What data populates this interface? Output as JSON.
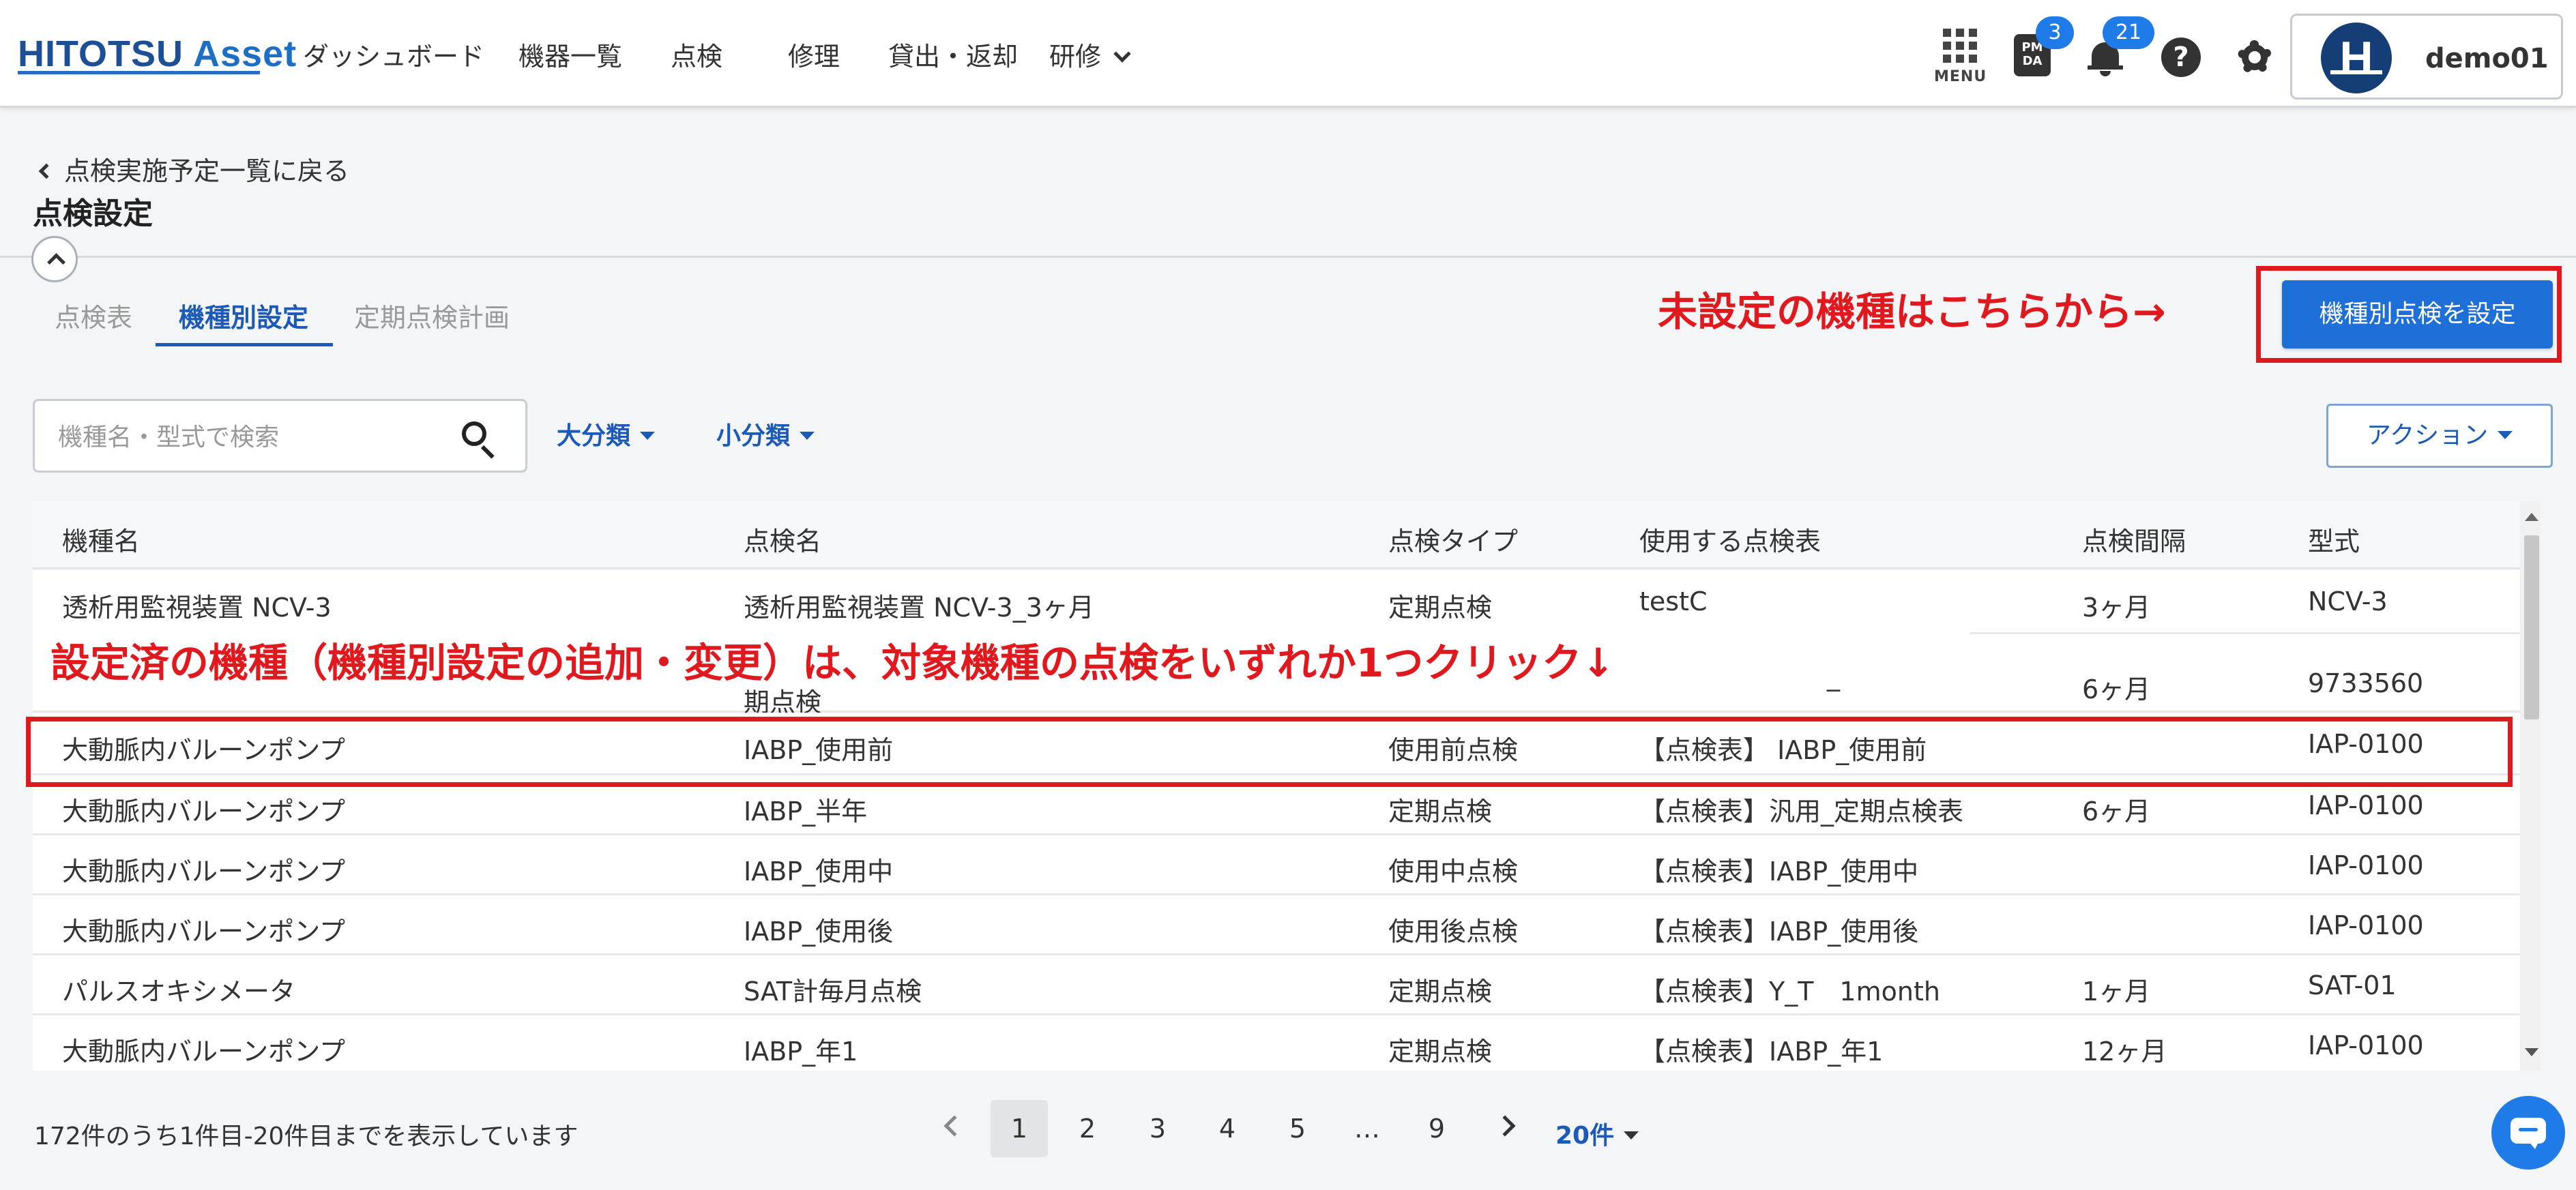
{
  "header": {
    "logo_main": "HITOTSU ",
    "logo_accent": "Asset",
    "nav": [
      {
        "label": "ダッシュボード"
      },
      {
        "label": "機器一覧"
      },
      {
        "label": "点検"
      },
      {
        "label": "修理"
      },
      {
        "label": "貸出・返却"
      },
      {
        "label": "研修"
      }
    ],
    "menu_label": "MENU",
    "pmda_label": "PMDA",
    "pmda_badge": "3",
    "notification_badge": "21",
    "help_symbol": "?",
    "user_initial": "H",
    "username": "demo01"
  },
  "page": {
    "back_label": "点検実施予定一覧に戻る",
    "title": "点検設定",
    "tabs": [
      {
        "label": "点検表"
      },
      {
        "label": "機種別設定"
      },
      {
        "label": "定期点検計画"
      }
    ],
    "annotation_top": "未設定の機種はこちらから→",
    "set_button": "機種別点検を設定",
    "search_placeholder": "機種名・型式で検索",
    "filter_major": "大分類",
    "filter_minor": "小分類",
    "action_button": "アクション"
  },
  "table": {
    "columns": [
      "機種名",
      "点検名",
      "点検タイプ",
      "使用する点検表",
      "点検間隔",
      "型式"
    ],
    "rows": [
      {
        "model": "透析用監視装置 NCV-3",
        "inspection": "透析用監視装置 NCV-3_3ヶ月",
        "type": "定期点検",
        "sheet": "testC",
        "interval": "3ヶ月",
        "code": "NCV-3"
      },
      {
        "model": "",
        "inspection": "期点検",
        "type": "",
        "sheet": "_",
        "interval": "6ヶ月",
        "code": "9733560"
      },
      {
        "model": "大動脈内バルーンポンプ",
        "inspection": "IABP_使用前",
        "type": "使用前点検",
        "sheet": "【点検表】 IABP_使用前",
        "interval": "",
        "code": "IAP-0100"
      },
      {
        "model": "大動脈内バルーンポンプ",
        "inspection": "IABP_半年",
        "type": "定期点検",
        "sheet": "【点検表】汎用_定期点検表",
        "interval": "6ヶ月",
        "code": "IAP-0100"
      },
      {
        "model": "大動脈内バルーンポンプ",
        "inspection": "IABP_使用中",
        "type": "使用中点検",
        "sheet": "【点検表】IABP_使用中",
        "interval": "",
        "code": "IAP-0100"
      },
      {
        "model": "大動脈内バルーンポンプ",
        "inspection": "IABP_使用後",
        "type": "使用後点検",
        "sheet": "【点検表】IABP_使用後",
        "interval": "",
        "code": "IAP-0100"
      },
      {
        "model": "パルスオキシメータ",
        "inspection": "SAT計毎月点検",
        "type": "定期点検",
        "sheet": "【点検表】Y_T　1month",
        "interval": "1ヶ月",
        "code": "SAT-01"
      },
      {
        "model": "大動脈内バルーンポンプ",
        "inspection": "IABP_年1",
        "type": "定期点検",
        "sheet": "【点検表】IABP_年1",
        "interval": "12ヶ月",
        "code": "IAP-0100"
      }
    ],
    "annotation_mid": "設定済の機種（機種別設定の追加・変更）は、対象機種の点検をいずれか1つクリック↓"
  },
  "pagination": {
    "summary": "172件のうち1件目-20件目までを表示しています",
    "pages": [
      "1",
      "2",
      "3",
      "4",
      "5",
      "…",
      "9"
    ],
    "per_page": "20件"
  },
  "colors": {
    "accent": "#1f6fd8",
    "annotation": "#e0191f",
    "brand": "#1c4f95"
  }
}
